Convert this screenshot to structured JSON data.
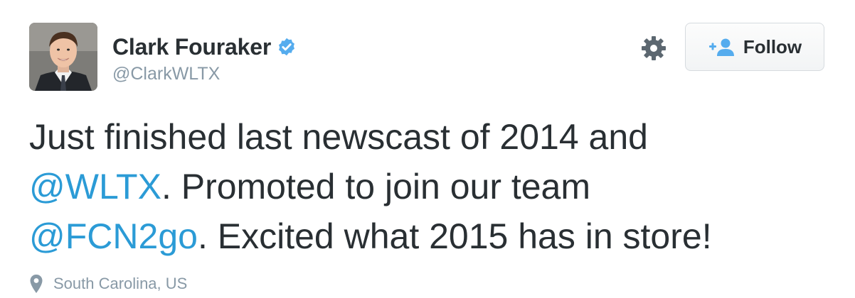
{
  "user": {
    "name": "Clark Fouraker",
    "handle": "@ClarkWLTX",
    "verified": true
  },
  "actions": {
    "settings_icon": "gear-icon",
    "follow_label": "Follow",
    "follow_icon": "add-user-icon"
  },
  "tweet": {
    "line1": "Just finished last newscast of 2014 and",
    "mention1": "@WLTX",
    "line2_rest": ". Promoted to join our team",
    "mention2": "@FCN2go",
    "line3_rest": ". Excited what 2015 has in store!"
  },
  "location": {
    "icon": "map-pin-icon",
    "label": "South Carolina, US"
  },
  "colors": {
    "text": "#292f33",
    "link": "#2b9bd6",
    "muted": "#8899a6",
    "verified": "#55acee"
  }
}
